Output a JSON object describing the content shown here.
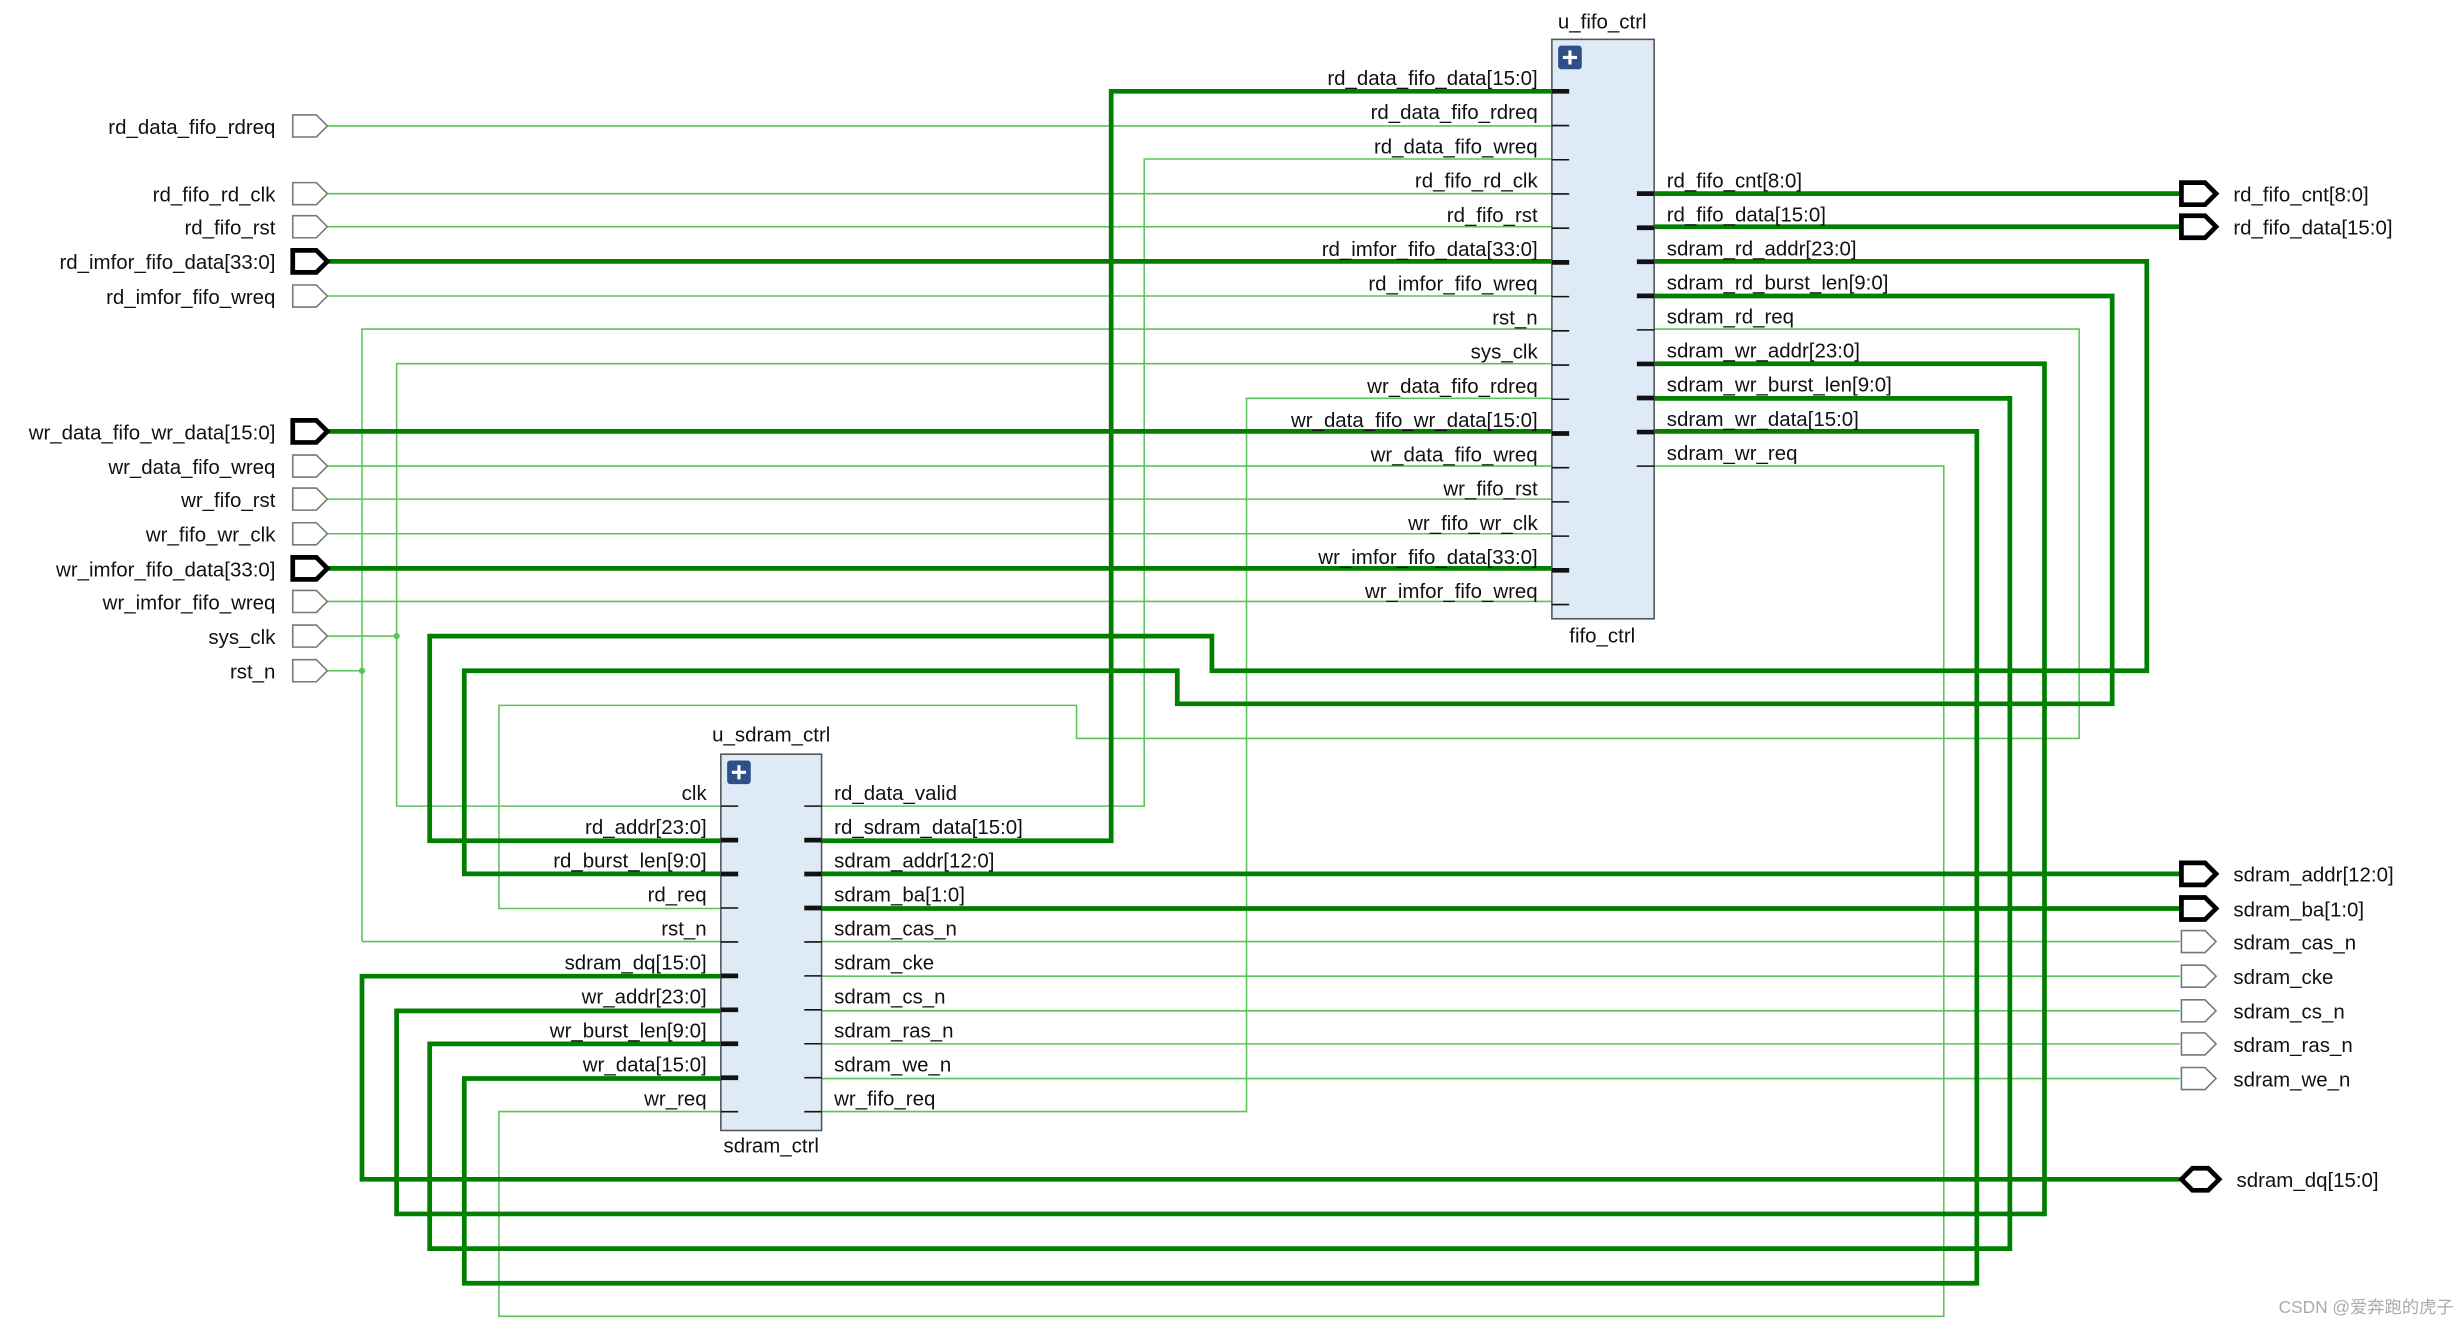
{
  "fifo_block": {
    "instance": "u_fifo_ctrl",
    "module": "fifo_ctrl",
    "inputs": [
      "rd_data_fifo_data[15:0]",
      "rd_data_fifo_rdreq",
      "rd_data_fifo_wreq",
      "rd_fifo_rd_clk",
      "rd_fifo_rst",
      "rd_imfor_fifo_data[33:0]",
      "rd_imfor_fifo_wreq",
      "rst_n",
      "sys_clk",
      "wr_data_fifo_rdreq",
      "wr_data_fifo_wr_data[15:0]",
      "wr_data_fifo_wreq",
      "wr_fifo_rst",
      "wr_fifo_wr_clk",
      "wr_imfor_fifo_data[33:0]",
      "wr_imfor_fifo_wreq"
    ],
    "outputs": [
      "rd_fifo_cnt[8:0]",
      "rd_fifo_data[15:0]",
      "sdram_rd_addr[23:0]",
      "sdram_rd_burst_len[9:0]",
      "sdram_rd_req",
      "sdram_wr_addr[23:0]",
      "sdram_wr_burst_len[9:0]",
      "sdram_wr_data[15:0]",
      "sdram_wr_req"
    ]
  },
  "sdram_block": {
    "instance": "u_sdram_ctrl",
    "module": "sdram_ctrl",
    "inputs": [
      "clk",
      "rd_addr[23:0]",
      "rd_burst_len[9:0]",
      "rd_req",
      "rst_n",
      "sdram_dq[15:0]",
      "wr_addr[23:0]",
      "wr_burst_len[9:0]",
      "wr_data[15:0]",
      "wr_req"
    ],
    "outputs": [
      "rd_data_valid",
      "rd_sdram_data[15:0]",
      "sdram_addr[12:0]",
      "sdram_ba[1:0]",
      "sdram_cas_n",
      "sdram_cke",
      "sdram_cs_n",
      "sdram_ras_n",
      "sdram_we_n",
      "wr_fifo_req"
    ]
  },
  "top_inputs": [
    "rd_data_fifo_rdreq",
    "rd_fifo_rd_clk",
    "rd_fifo_rst",
    "rd_imfor_fifo_data[33:0]",
    "rd_imfor_fifo_wreq",
    "wr_data_fifo_wr_data[15:0]",
    "wr_data_fifo_wreq",
    "wr_fifo_rst",
    "wr_fifo_wr_clk",
    "wr_imfor_fifo_data[33:0]",
    "wr_imfor_fifo_wreq",
    "sys_clk",
    "rst_n"
  ],
  "top_outputs": [
    "rd_fifo_cnt[8:0]",
    "rd_fifo_data[15:0]",
    "sdram_addr[12:0]",
    "sdram_ba[1:0]",
    "sdram_cas_n",
    "sdram_cke",
    "sdram_cs_n",
    "sdram_ras_n",
    "sdram_we_n"
  ],
  "top_inout": "sdram_dq[15:0]",
  "colors": {
    "wire": "#5cc35c",
    "bus": "#007f00",
    "block_fill": "#dfeaf7"
  },
  "expand_icon": "plus-icon",
  "watermark": "CSDN @爱奔跑的虎子"
}
